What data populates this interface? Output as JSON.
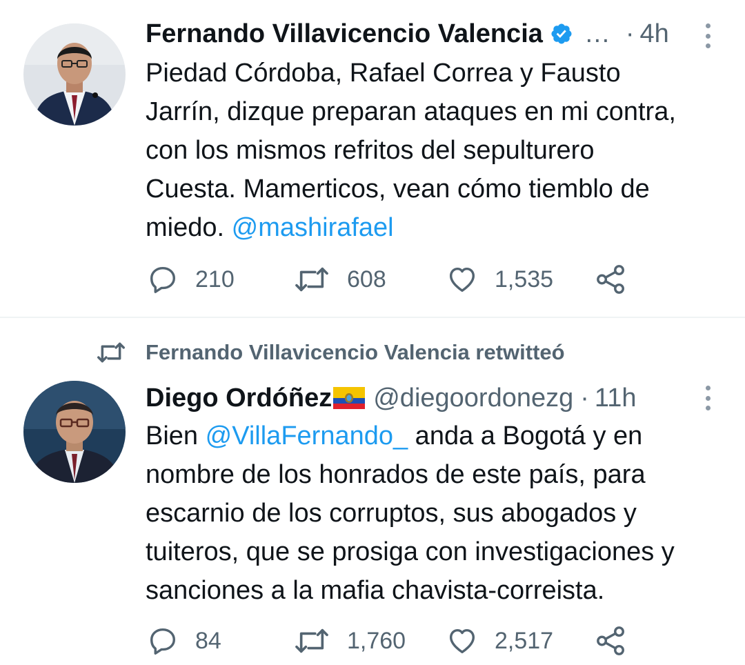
{
  "colors": {
    "accent": "#1d9bf0",
    "secondary_text": "#536471",
    "primary_text": "#0f1419",
    "divider": "#eff3f4"
  },
  "tweets": [
    {
      "author_name": "Fernando Villavicencio Valencia",
      "verified_icon": "verified-badge-icon",
      "handle_truncated": "…",
      "separator": "·",
      "time": "4h",
      "lines": [
        "Piedad Córdoba, Rafael Correa y Fausto",
        "Jarrín, dizque preparan ataques en mi contra,",
        "con los mismos refritos del sepulturero",
        "Cuesta. Mamerticos, vean cómo tiemblo de"
      ],
      "last_line_text": "miedo. ",
      "mention": "@mashirafael",
      "replies": "210",
      "retweets": "608",
      "likes": "1,535"
    },
    {
      "retweeted_by": "Fernando Villavicencio Valencia retwitteó",
      "author_name": "Diego Ordóñez",
      "flag_icon": "ecuador-flag-icon",
      "handle": "@diegoordonezg",
      "separator": "·",
      "time": "11h",
      "first_line_pre": "Bien ",
      "mention": "@VillaFernando_",
      "first_line_post": " anda a Bogotá y en",
      "lines": [
        "nombre de los honrados de este país, para",
        "escarnio de los corruptos, sus abogados y",
        "tuiteros, que se prosiga con investigaciones y",
        "sanciones a la mafia chavista-correista."
      ],
      "replies": "84",
      "retweets": "1,760",
      "likes": "2,517"
    }
  ]
}
